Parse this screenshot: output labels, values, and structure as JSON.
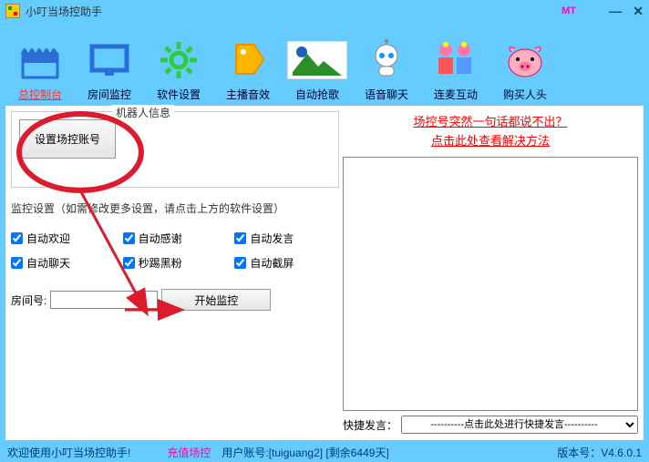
{
  "titlebar": {
    "title": "小叮当场控助手",
    "badge": "MT"
  },
  "toolbar": {
    "items": [
      {
        "label": "总控制台"
      },
      {
        "label": "房间监控"
      },
      {
        "label": "软件设置"
      },
      {
        "label": "主播音效"
      },
      {
        "label": "自动抢歌"
      },
      {
        "label": "语音聊天"
      },
      {
        "label": "连麦互动"
      },
      {
        "label": "购买人头"
      }
    ]
  },
  "left": {
    "group_legend": "机器人信息",
    "set_account_btn": "设置场控账号",
    "monitor_settings_label": "监控设置（如需修改更多设置，请点击上方的软件设置）",
    "checks": {
      "auto_welcome": "自动欢迎",
      "auto_thank": "自动感谢",
      "auto_speak": "自动发言",
      "auto_chat": "自动聊天",
      "kick_black": "秒踢黑粉",
      "auto_shot": "自动截屏"
    },
    "room_label": "房间号:",
    "start_btn": "开始监控"
  },
  "right": {
    "notice_line1": "场控号突然一句话都说不出？",
    "notice_line2": "点击此处查看解决方法",
    "quick_label": "快捷发言：",
    "quick_option": "----------点击此处进行快捷发言----------"
  },
  "status": {
    "welcome": "欢迎使用小叮当场控助手!",
    "recharge": "充值场控",
    "user": "用户账号:[tuiguang2]   [剩余6449天]",
    "version": "版本号：V4.6.0.1"
  }
}
